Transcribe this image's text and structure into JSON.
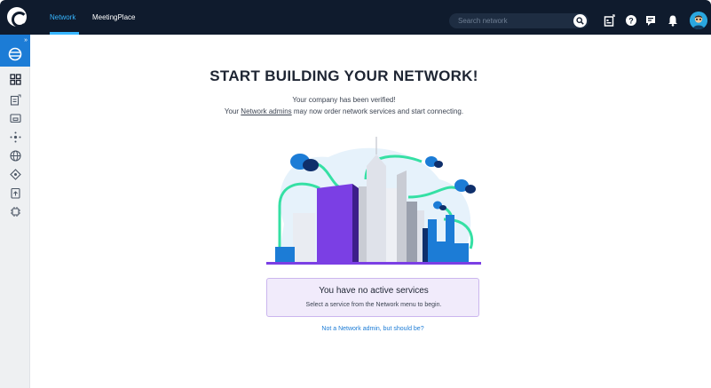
{
  "topbar": {
    "tabs": [
      {
        "label": "Network",
        "active": true
      },
      {
        "label": "MeetingPlace",
        "active": false
      }
    ],
    "search_placeholder": "Search network",
    "icons": [
      "logo",
      "search-icon",
      "service-key-icon",
      "help-icon",
      "chat-icon",
      "bell-icon",
      "avatar"
    ]
  },
  "sidebar": {
    "items": [
      "network-globe-icon",
      "dashboard-icon",
      "services-icon",
      "ports-icon",
      "network-topology-icon",
      "globe-icon",
      "cloud-router-icon",
      "documents-icon",
      "chip-icon"
    ]
  },
  "main": {
    "headline": "START BUILDING YOUR NETWORK!",
    "line1": "Your company has been verified!",
    "line2_prefix": "Your ",
    "line2_link": "Network admins",
    "line2_suffix": " may now order network services and start connecting.",
    "notice_title": "You have no active services",
    "notice_sub": "Select a service from the Network menu to begin.",
    "admin_link": "Not a Network admin, but should be?"
  },
  "colors": {
    "topbar": "#0f1b2d",
    "accent": "#37b6ff",
    "sidebar_active": "#1c7cd6",
    "purple": "#7b3fe4",
    "notice_bg": "#f1ebfb"
  }
}
